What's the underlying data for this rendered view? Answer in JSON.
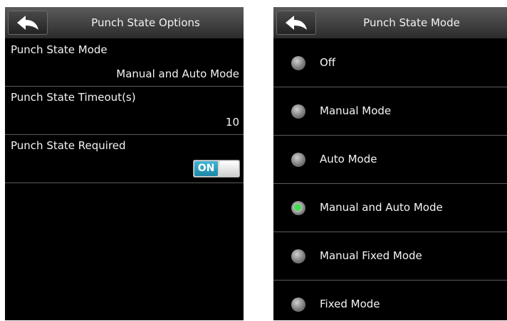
{
  "left_screen": {
    "title": "Punch State Options",
    "rows": [
      {
        "label": "Punch State Mode",
        "value": "Manual and Auto Mode"
      },
      {
        "label": "Punch State Timeout(s)",
        "value": "10"
      },
      {
        "label": "Punch State Required",
        "toggle": "ON"
      }
    ]
  },
  "right_screen": {
    "title": "Punch State Mode",
    "options": [
      {
        "label": "Off",
        "selected": false
      },
      {
        "label": "Manual Mode",
        "selected": false
      },
      {
        "label": "Auto Mode",
        "selected": false
      },
      {
        "label": "Manual and Auto Mode",
        "selected": true
      },
      {
        "label": "Manual Fixed Mode",
        "selected": false
      },
      {
        "label": "Fixed Mode",
        "selected": false
      }
    ]
  },
  "colors": {
    "selected_radio": "#39e04a",
    "toggle_on": "#2aa3c6",
    "background": "#000000"
  },
  "icons": {
    "back": "back-arrow-icon"
  }
}
